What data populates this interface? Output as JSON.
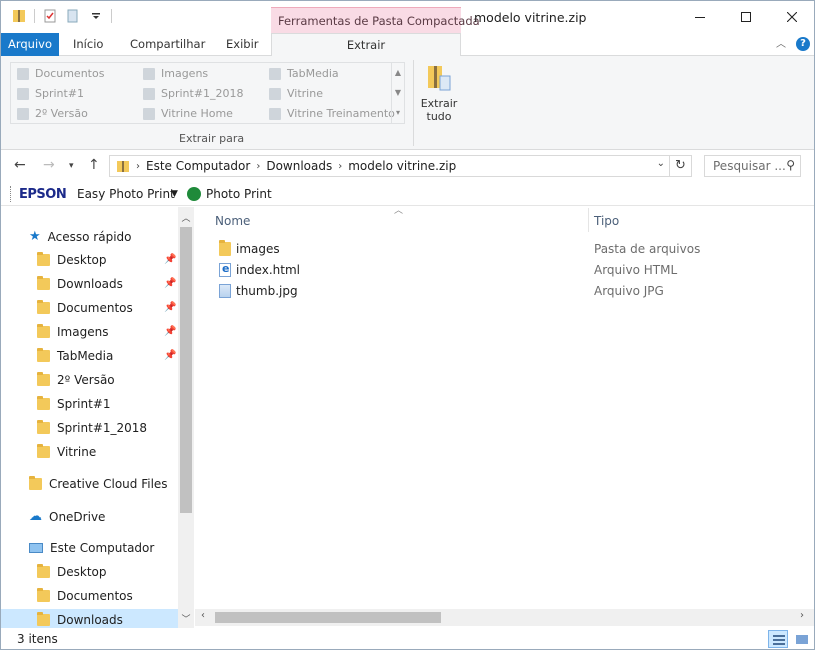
{
  "window": {
    "title": "modelo vitrine.zip",
    "context_tab": "Ferramentas de Pasta Compactada"
  },
  "ribbon_tabs": {
    "arquivo": "Arquivo",
    "inicio": "Início",
    "compartilhar": "Compartilhar",
    "exibir": "Exibir",
    "extrair": "Extrair"
  },
  "ribbon": {
    "gallery": [
      "Documentos",
      "Imagens",
      "TabMedia",
      "Sprint#1",
      "Sprint#1_2018",
      "Vitrine",
      "2º Versão",
      "Vitrine Home",
      "Vitrine Treinamento"
    ],
    "group_label": "Extrair para",
    "extract_all_line1": "Extrair",
    "extract_all_line2": "tudo"
  },
  "address": {
    "crumbs": [
      "Este Computador",
      "Downloads",
      "modelo vitrine.zip"
    ],
    "search_placeholder": "Pesquisar ..."
  },
  "epson": {
    "logo": "EPSON",
    "easy_photo_print": "Easy Photo Print",
    "photo_print": "Photo Print"
  },
  "navpane": {
    "quick_access": "Acesso rápido",
    "quick_items": [
      "Desktop",
      "Downloads",
      "Documentos",
      "Imagens",
      "TabMedia",
      "2º Versão",
      "Sprint#1",
      "Sprint#1_2018",
      "Vitrine"
    ],
    "creative_cloud": "Creative Cloud Files",
    "onedrive": "OneDrive",
    "this_pc": "Este Computador",
    "pc_items": [
      "Desktop",
      "Documentos",
      "Downloads"
    ]
  },
  "columns": {
    "name": "Nome",
    "type": "Tipo"
  },
  "files": [
    {
      "name": "images",
      "type": "Pasta de arquivos",
      "icon": "folder-icon"
    },
    {
      "name": "index.html",
      "type": "Arquivo HTML",
      "icon": "html-file-icon"
    },
    {
      "name": "thumb.jpg",
      "type": "Arquivo JPG",
      "icon": "image-file-icon"
    }
  ],
  "status": {
    "item_count": "3 itens"
  },
  "colors": {
    "accent": "#1979ca",
    "context_tab": "#f9dbe5",
    "selection": "#cce8ff"
  }
}
